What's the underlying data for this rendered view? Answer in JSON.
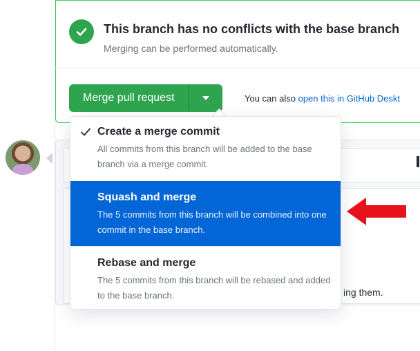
{
  "merge_status": {
    "title": "This branch has no conflicts with the base branch",
    "subtitle": "Merging can be performed automatically.",
    "icon": "check-circle-icon",
    "color": "#2ea44f"
  },
  "merge_button": {
    "label": "Merge pull request",
    "dropdown_icon": "triangle-down-icon"
  },
  "also": {
    "prefix": "You can also ",
    "link": "open this in GitHub Deskt"
  },
  "background": {
    "cut_text": "ing them."
  },
  "merge_menu": {
    "items": [
      {
        "title": "Create a merge commit",
        "description": "All commits from this branch will be added to the base branch via a merge commit.",
        "checked": true
      },
      {
        "title": "Squash and merge",
        "description": "The 5 commits from this branch will be combined into one commit in the base branch.",
        "selected": true
      },
      {
        "title": "Rebase and merge",
        "description": "The 5 commits from this branch will be rebased and added to the base branch."
      }
    ]
  },
  "colors": {
    "accent": "#0366d6",
    "success": "#2ea44f",
    "annotation_arrow": "#e8121a"
  }
}
